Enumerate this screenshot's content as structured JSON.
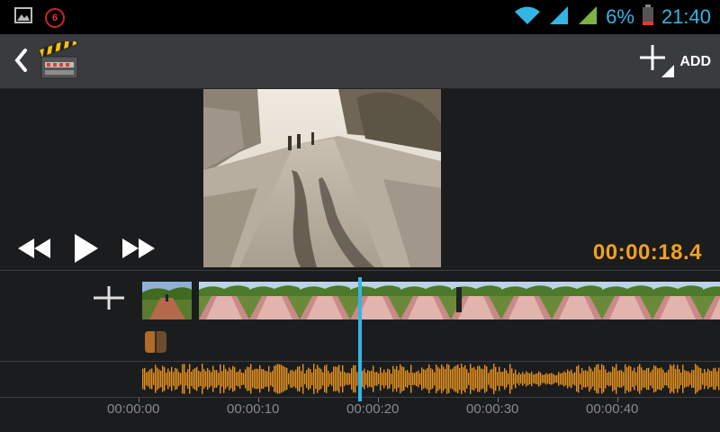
{
  "status_bar": {
    "notification_count": "6",
    "battery_percent": "6%",
    "time": "21:40",
    "icons": [
      "gallery-icon",
      "notification-badge",
      "wifi-icon",
      "signal-icon",
      "signal-icon",
      "battery-icon"
    ]
  },
  "action_bar": {
    "back_icon": "chevron-left-icon",
    "app_icon": "clapperboard-icon",
    "add_label": "ADD"
  },
  "player": {
    "timecode": "00:00:18.4",
    "controls": [
      "rewind-icon",
      "play-icon",
      "fast-forward-icon"
    ]
  },
  "timeline": {
    "playhead_position": "00:00:18.4",
    "ruler_labels": [
      "00:00:00",
      "00:00:10",
      "00:00:20",
      "00:00:30",
      "00:00:40"
    ]
  },
  "colors": {
    "accent_blue": "#33b5e5",
    "accent_orange": "#f0a020",
    "waveform": "#e89320",
    "action_bar": "#3a3b3e"
  }
}
